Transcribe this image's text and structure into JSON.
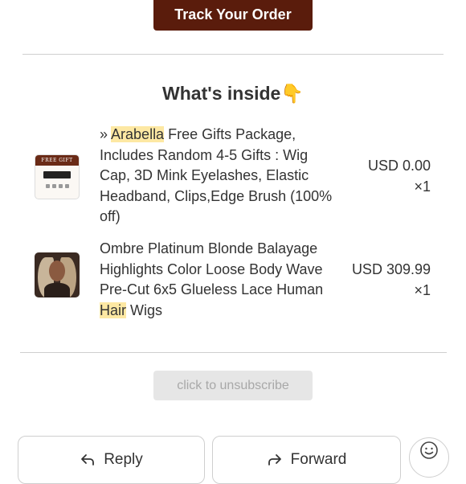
{
  "track_button": {
    "label": "Track Your Order"
  },
  "section": {
    "title": "What's inside",
    "emoji": "👇"
  },
  "items": [
    {
      "prefix": "» ",
      "highlight": "Arabella",
      "rest": " Free Gifts Package, Includes Random 4-5 Gifts : Wig Cap, 3D Mink Eyelashes, Elastic Headband, Clips,Edge Brush (100% off)",
      "price": "USD 0.00",
      "qty": "×1",
      "thumb_label": "FREE GIFT",
      "thumb_icon": "gift-package-image"
    },
    {
      "text_before": "Ombre Platinum Blonde Balayage Highlights Color Loose Body Wave Pre-Cut 6x5 Glueless Lace Human ",
      "highlight": "Hair",
      "text_after": " Wigs",
      "price": "USD 309.99",
      "qty": "×1",
      "thumb_icon": "wig-model-image"
    }
  ],
  "unsubscribe": {
    "label": "click to unsubscribe"
  },
  "actions": {
    "reply": {
      "label": "Reply",
      "icon": "reply-arrow-icon"
    },
    "forward": {
      "label": "Forward",
      "icon": "forward-arrow-icon"
    },
    "emoji": {
      "icon": "smiley-icon"
    }
  },
  "colors": {
    "brand": "#5a1c0c",
    "highlight": "#fde8a3"
  }
}
